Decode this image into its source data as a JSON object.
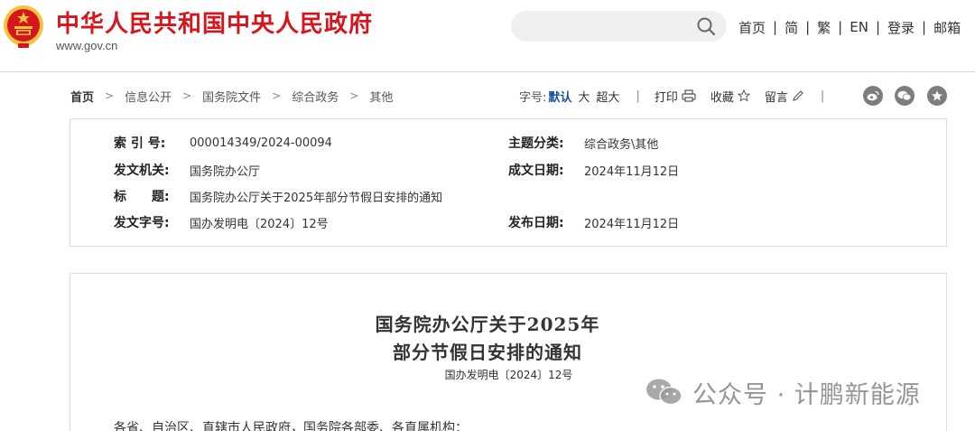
{
  "header": {
    "site_title": "中华人民共和国中央人民政府",
    "site_url": "www.gov.cn",
    "search": {
      "placeholder": "",
      "value": ""
    },
    "nav": [
      "首页",
      "简",
      "繁",
      "EN",
      "登录",
      "邮箱"
    ]
  },
  "breadcrumb": {
    "items": [
      "首页",
      "信息公开",
      "国务院文件",
      "综合政务",
      "其他"
    ]
  },
  "tools": {
    "font_size_label": "字号:",
    "font_default": "默认",
    "font_large": "大",
    "font_xlarge": "超大",
    "print": "打印",
    "favorite": "收藏",
    "comment": "留言"
  },
  "share_icons": [
    "weibo-icon",
    "wechat-icon",
    "favorite-star-icon"
  ],
  "meta": {
    "index_no_label": "索 引 号:",
    "index_no": "000014349/2024-00094",
    "category_label": "主题分类:",
    "category": "综合政务\\其他",
    "issuer_label": "发文机关:",
    "issuer": "国务院办公厅",
    "written_date_label": "成文日期:",
    "written_date": "2024年11月12日",
    "title_label": "标　　题:",
    "title": "国务院办公厅关于2025年部分节假日安排的通知",
    "doc_no_label": "发文字号:",
    "doc_no": "国办发明电〔2024〕12号",
    "publish_date_label": "发布日期:",
    "publish_date": "2024年11月12日"
  },
  "article": {
    "title_line1": "国务院办公厅关于2025年",
    "title_line2": "部分节假日安排的通知",
    "doc_number": "国办发明电〔2024〕12号",
    "salutation": "各省、自治区、直辖市人民政府，国务院各部委、各直属机构："
  },
  "watermark": {
    "text": "公众号 · 计鹏新能源"
  },
  "colors": {
    "brand_red": "#d5161d",
    "link_blue": "#1a50a3",
    "icon_gray": "#7d7d7d"
  }
}
